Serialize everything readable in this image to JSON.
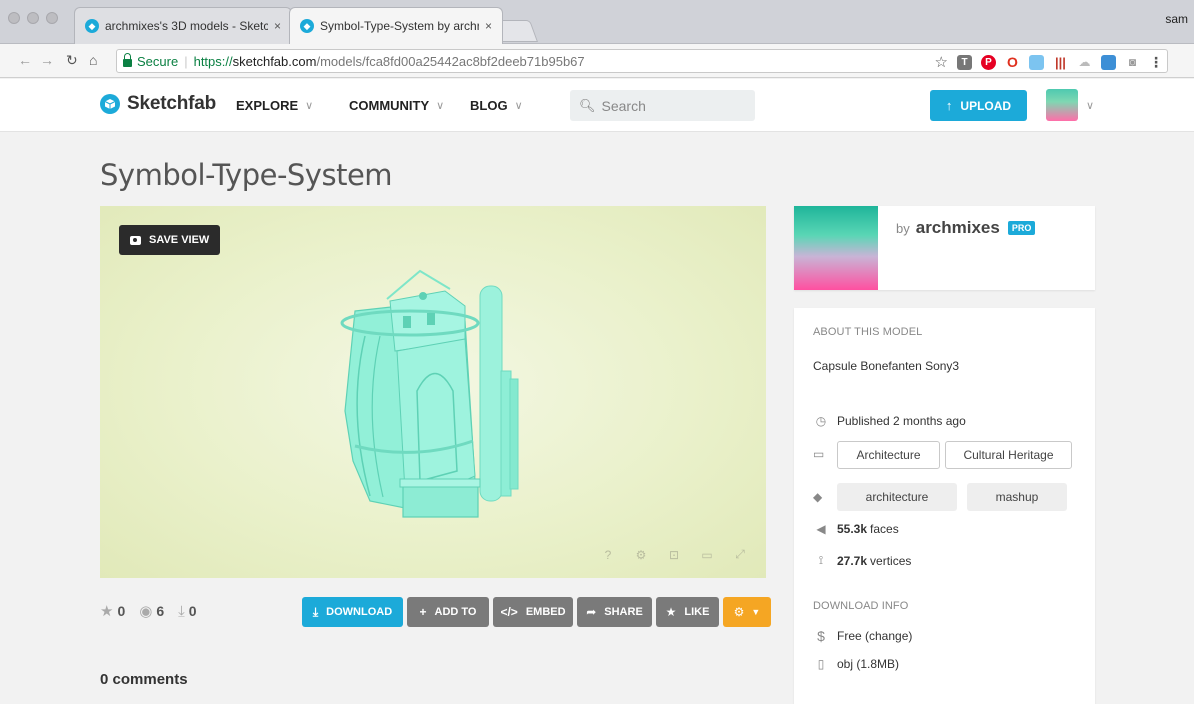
{
  "browser": {
    "tabs": [
      {
        "title": "archmixes's 3D models - Sketc",
        "close": "×"
      },
      {
        "title": "Symbol-Type-System by archr",
        "close": "×"
      }
    ],
    "user": "sam",
    "secure_label": "Secure",
    "url_scheme": "https://",
    "url_host": "sketchfab.com",
    "url_path": "/models/fca8fd00a25442ac8bf2deeb71b95b67"
  },
  "header": {
    "logo": "Sketchfab",
    "nav": [
      "EXPLORE",
      "COMMUNITY",
      "BLOG"
    ],
    "search_placeholder": "Search",
    "upload_label": "UPLOAD"
  },
  "model": {
    "title": "Symbol-Type-System",
    "save_view": "SAVE VIEW",
    "stats": {
      "likes": "0",
      "views": "6",
      "downloads": "0"
    },
    "actions": {
      "download": "DOWNLOAD",
      "add_to": "ADD TO",
      "embed": "EMBED",
      "share": "SHARE",
      "like": "LIKE"
    },
    "comments": "0 comments"
  },
  "author": {
    "by": "by",
    "name": "archmixes",
    "badge": "PRO"
  },
  "about": {
    "heading": "ABOUT THIS MODEL",
    "description": "Capsule Bonefanten Sony3",
    "published": "Published 2 months ago",
    "categories": [
      "Architecture",
      "Cultural Heritage"
    ],
    "tags": [
      "architecture",
      "mashup"
    ],
    "faces_value": "55.3k",
    "faces_label": "faces",
    "vertices_value": "27.7k",
    "vertices_label": "vertices"
  },
  "download": {
    "heading": "DOWNLOAD INFO",
    "price": "Free (change)",
    "format": "obj (1.8MB)"
  },
  "colors": {
    "accent": "#1caad9",
    "action_grey": "#7a7a7a",
    "action_orange": "#f5a623",
    "viewer_bg": "#eaf1cb",
    "model": "#8ff0d8"
  }
}
